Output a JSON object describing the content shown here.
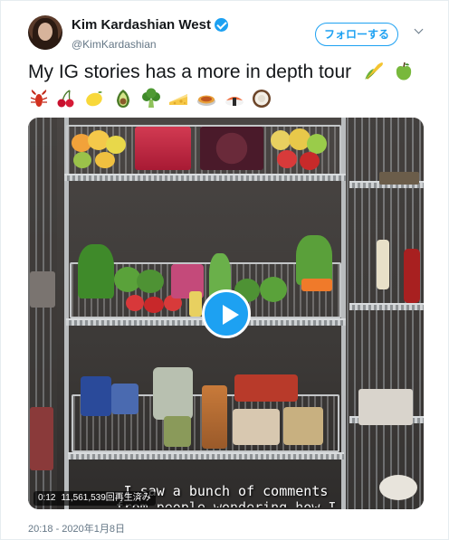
{
  "author": {
    "display_name": "Kim Kardashian West",
    "handle": "@KimKardashian",
    "verified": true
  },
  "follow_label": "フォローする",
  "tweet": {
    "text": "My IG stories has a more in depth tour",
    "emojis": [
      "corn",
      "green-apple",
      "lobster",
      "cherries",
      "lemon",
      "avocado",
      "broccoli",
      "cheese",
      "pie",
      "sushi",
      "coconut"
    ]
  },
  "video": {
    "duration": "0:12",
    "views": "11,561,539回再生済み",
    "caption_line1": "I saw a bunch of comments",
    "caption_line2": "from people wondering how I"
  },
  "timestamp": "20:18 - 2020年1月8日",
  "colors": {
    "accent": "#1da1f2",
    "text": "#14171a",
    "muted": "#657786"
  }
}
